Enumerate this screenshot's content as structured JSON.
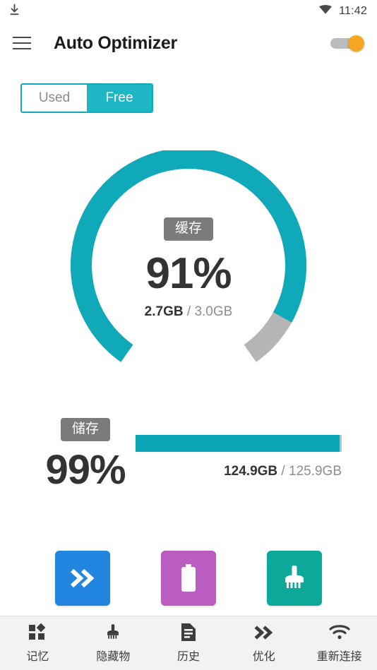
{
  "status_bar": {
    "download_icon": "download-icon",
    "wifi_icon": "wifi-icon",
    "time": "11:42"
  },
  "app_bar": {
    "menu_icon": "hamburger-menu-icon",
    "title": "Auto Optimizer",
    "toggle": {
      "name": "auto-optimize-toggle",
      "state": "on",
      "thumb_color": "#f5a623",
      "track_color": "#bcbcbc"
    }
  },
  "segmented_control": {
    "options": [
      {
        "label": "Used",
        "selected": false
      },
      {
        "label": "Free",
        "selected": true
      }
    ],
    "accent_color": "#12aabb"
  },
  "cache_gauge": {
    "badge": "缓存",
    "percent": "91%",
    "used": "2.7GB",
    "separator": " / ",
    "total": "3.0GB",
    "value": 91,
    "arc_color": "#0fa9ba",
    "track_color": "#b5b5b5"
  },
  "storage": {
    "badge": "储存",
    "percent": "99%",
    "used": "124.9GB",
    "separator": " / ",
    "total": "125.9GB",
    "value": 99,
    "bar_color": "#0aa6b7",
    "track_color": "#bdbdbd"
  },
  "action_tiles": [
    {
      "name": "boost-button",
      "icon": "double-chevron-icon",
      "color": "#2286e0"
    },
    {
      "name": "battery-button",
      "icon": "battery-icon",
      "color": "#bb5cc0"
    },
    {
      "name": "clean-button",
      "icon": "broom-icon",
      "color": "#0ca99b"
    }
  ],
  "bottom_nav": [
    {
      "label": "记忆",
      "icon": "grid-memory-icon"
    },
    {
      "label": "隐藏物",
      "icon": "broom-icon"
    },
    {
      "label": "历史",
      "icon": "document-icon"
    },
    {
      "label": "优化",
      "icon": "double-chevron-icon"
    },
    {
      "label": "重新连接",
      "icon": "wifi-icon"
    }
  ]
}
